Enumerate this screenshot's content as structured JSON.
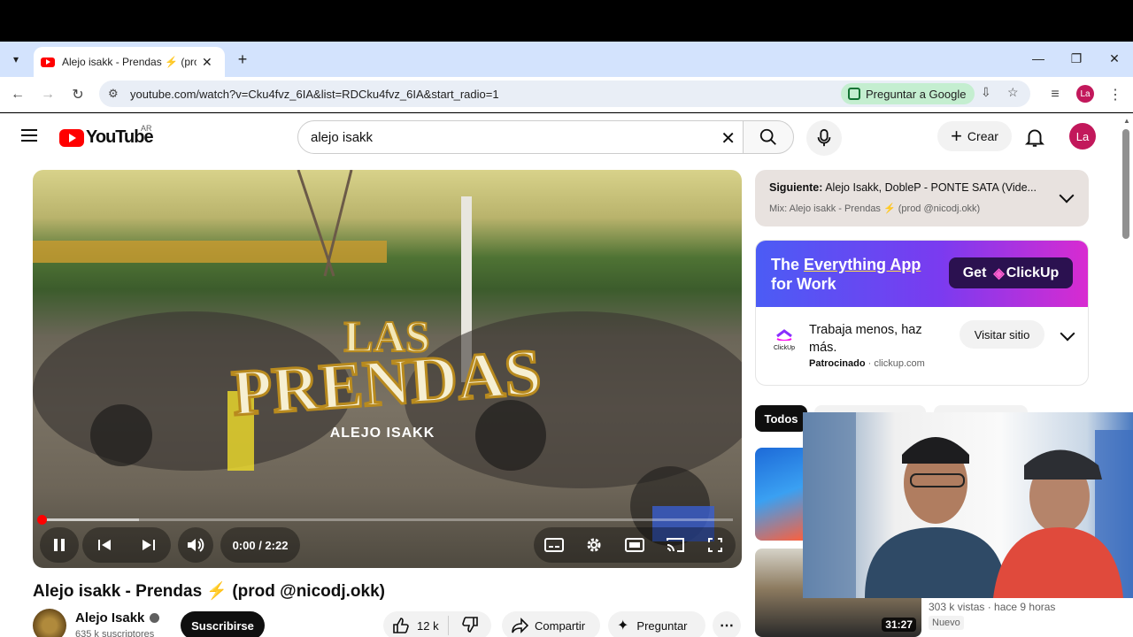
{
  "browser": {
    "tab_title": "Alejo isakk - Prendas ⚡ (prod",
    "url": "youtube.com/watch?v=Cku4fvz_6IA&list=RDCku4fvz_6IA&start_radio=1",
    "ask_google_label": "Preguntar a Google",
    "profile_initials": "La"
  },
  "header": {
    "logo_text": "YouTube",
    "country_code": "AR",
    "search_query": "alejo isakk",
    "create_label": "Crear",
    "avatar_initials": "La"
  },
  "player": {
    "overlay_title": "LAS PRENDAS",
    "overlay_artist": "ALEJO ISAKK",
    "time_display": "0:00 / 2:22",
    "progress_fraction": 0.0
  },
  "video": {
    "title": "Alejo isakk - Prendas ⚡ (prod @nicodj.okk)",
    "channel_name": "Alejo Isakk",
    "subscribers": "635 k suscriptores",
    "subscribe_label": "Suscribirse",
    "likes": "12 k",
    "share_label": "Compartir",
    "ask_label": "Preguntar"
  },
  "up_next": {
    "label_bold": "Siguiente:",
    "label_title": "Alejo Isakk, DobleP - PONTE SATA (Vide...",
    "mix_title": "Mix: Alejo isakk - Prendas ⚡ (prod @nicodj.okk)"
  },
  "ad": {
    "headline_1": "The",
    "headline_emph": "Everything App",
    "headline_2": "for Work",
    "cta_get": "Get",
    "cta_brand": "ClickUp",
    "icon_label": "ClickUp",
    "body": "Trabaja menos, haz más.",
    "sponsored": "Patrocinado",
    "domain": "clickup.com",
    "visit_label": "Visitar sitio"
  },
  "chips": {
    "all": "Todos"
  },
  "recommendations": [
    {
      "duration": "31:27",
      "views_time": "303 k vistas · hace 9 horas",
      "badge": "Nuevo"
    }
  ],
  "colors": {
    "youtube_red": "#ff0000",
    "tabstrip": "#d3e3fd",
    "ask_google_bg": "#c4eed0",
    "avatar": "#c2185b"
  }
}
